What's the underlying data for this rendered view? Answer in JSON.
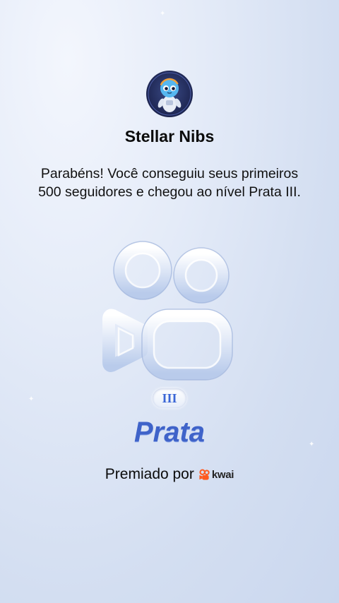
{
  "profile": {
    "username": "Stellar Nibs",
    "avatar_icon": "astronaut-avatar-icon"
  },
  "message": "Parabéns! Você conseguiu seus primeiros 500 seguidores e chegou ao nível Prata III.",
  "badge": {
    "icon": "kwai-camera-badge-icon",
    "tier": "III",
    "level_name": "Prata",
    "accent_color": "#3f63c9"
  },
  "footer": {
    "awarded_by": "Premiado por",
    "brand": "kwai",
    "brand_color": "#ff5a1f"
  }
}
